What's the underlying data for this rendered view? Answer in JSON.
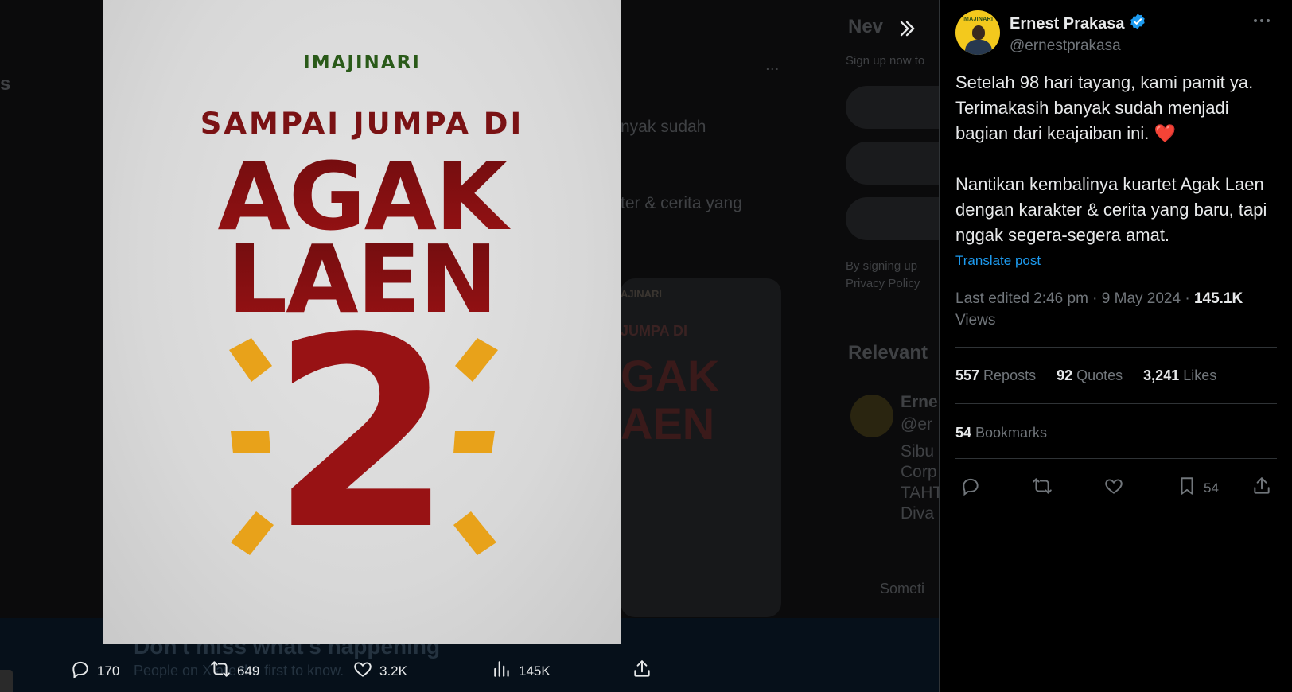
{
  "background": {
    "fragments": [
      "s",
      "Nev",
      "Sign up now to",
      "...",
      "nyak sudah",
      "ter & cerita yang",
      "By signing up",
      "Privacy Policy",
      "AJINARI",
      "JUMPA DI",
      "GAK",
      "AEN",
      "Relevant",
      "Erne",
      "@er",
      "Sibu",
      "Corp",
      "TAHT",
      "Diva",
      "Someti",
      "Don't miss what's happening",
      "People on X are the first to know."
    ]
  },
  "poster": {
    "brand": "IMAJINARI",
    "line1": "SAMPAI JUMPA DI",
    "title_line1": "AGAK",
    "title_line2": "LAEN",
    "number": "2"
  },
  "bottom_bar": {
    "replies": "170",
    "reposts": "649",
    "likes": "3.2K",
    "views": "145K"
  },
  "tweet": {
    "display_name": "Ernest Prakasa",
    "handle": "@ernestprakasa",
    "avatar_brand": "IMAJINARI",
    "text_p1": "Setelah 98 hari tayang, kami pamit ya. Terimakasih banyak sudah menjadi bagian dari keajaiban ini. ❤️",
    "text_p2": "Nantikan kembalinya kuartet Agak Laen dengan karakter & cerita yang baru, tapi nggak segera-segera amat.",
    "translate_label": "Translate post",
    "edited_label": "Last edited 2:46 pm · 9 May 2024 · ",
    "views_count": "145.1K",
    "views_label": " Views",
    "reposts_count": "557",
    "reposts_label": " Reposts",
    "quotes_count": "92",
    "quotes_label": " Quotes",
    "likes_count": "3,241",
    "likes_label": " Likes",
    "bookmarks_count": "54",
    "bookmarks_label": " Bookmarks",
    "bookmark_action_count": "54"
  },
  "colors": {
    "accent": "#1d9bf0",
    "poster_red": "#8f0f10",
    "poster_orange": "#e8a21a",
    "poster_green": "#2a5a19",
    "heart": "#e0245e"
  },
  "icons": [
    "expand-icon",
    "reply-icon",
    "repost-icon",
    "like-icon",
    "views-icon",
    "share-icon",
    "verified-icon",
    "more-icon",
    "bookmark-icon"
  ]
}
